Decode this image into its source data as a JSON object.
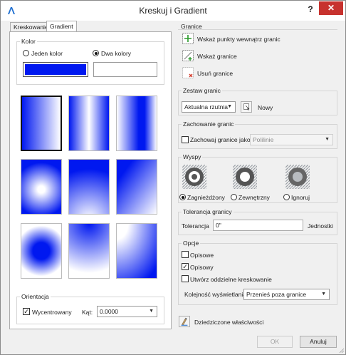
{
  "window": {
    "title": "Kreskuj i Gradient",
    "help": "?",
    "close": "✕"
  },
  "tabs": [
    {
      "label": "Kreskowanie",
      "active": false
    },
    {
      "label": "Gradient",
      "active": true
    }
  ],
  "color": {
    "legend": "Kolor",
    "one_color_label": "Jeden kolor",
    "two_colors_label": "Dwa kolory",
    "selected": "two",
    "color1": "#0018f0",
    "color2": "#ffffff"
  },
  "orientation": {
    "legend": "Orientacja",
    "centered_label": "Wycentrowany",
    "centered_checked": true,
    "angle_label": "Kąt:",
    "angle_value": "0.0000"
  },
  "boundaries": {
    "legend": "Granice",
    "pick_points_label": "Wskaż punkty wewnątrz granic",
    "select_objects_label": "Wskaż granice",
    "remove_label": "Usuń granice"
  },
  "boundary_set": {
    "legend": "Zestaw granic",
    "dropdown_value": "Aktualna rzutnia",
    "new_label": "Nowy"
  },
  "retain": {
    "legend": "Zachowanie granic",
    "checkbox_label": "Zachowaj granice jako",
    "checked": false,
    "dropdown_value": "Polilinie"
  },
  "islands": {
    "legend": "Wyspy",
    "options": [
      {
        "label": "Zagnieżdżony",
        "selected": true
      },
      {
        "label": "Zewnętrzny",
        "selected": false
      },
      {
        "label": "Ignoruj",
        "selected": false
      }
    ]
  },
  "tolerance": {
    "legend": "Tolerancja granicy",
    "label": "Tolerancja",
    "value": "0\"",
    "unit": "Jednostki"
  },
  "options": {
    "legend": "Opcje",
    "annotative_label": "Opisowe",
    "annotative_checked": false,
    "associative_label": "Opisowy",
    "associative_checked": true,
    "separate_label": "Utwórz oddzielne kreskowanie",
    "separate_checked": false,
    "draw_order_label": "Kolejność wyświetlania",
    "draw_order_value": "Przenieś poza granice"
  },
  "inherit_label": "Dziedziczone właściwości",
  "ok_label": "OK",
  "cancel_label": "Anuluj",
  "colors": {
    "gradient_blue": "#0018f0",
    "close_red": "#c7322e"
  }
}
